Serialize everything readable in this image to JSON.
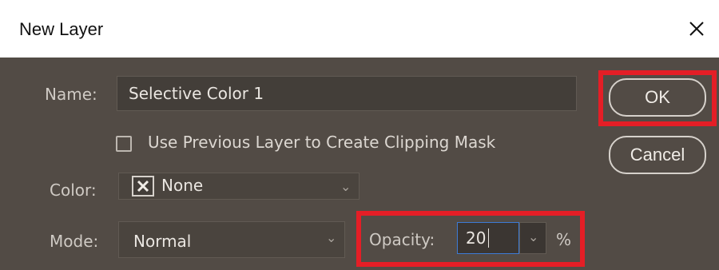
{
  "dialog": {
    "title": "New Layer",
    "close_icon": "close-x-icon"
  },
  "name": {
    "label": "Name:",
    "value": "Selective Color 1"
  },
  "clipping": {
    "label": "Use Previous Layer to Create Clipping Mask",
    "checked": false
  },
  "color": {
    "label": "Color:",
    "swatch_icon": "none-x-icon",
    "value": "None"
  },
  "mode": {
    "label": "Mode:",
    "value": "Normal"
  },
  "opacity": {
    "label": "Opacity:",
    "value": "20",
    "unit": "%"
  },
  "buttons": {
    "ok": "OK",
    "cancel": "Cancel"
  },
  "colors": {
    "panel": "#524b45",
    "field": "#433e39",
    "highlight": "#e41e26",
    "focus": "#3d7bd6"
  }
}
